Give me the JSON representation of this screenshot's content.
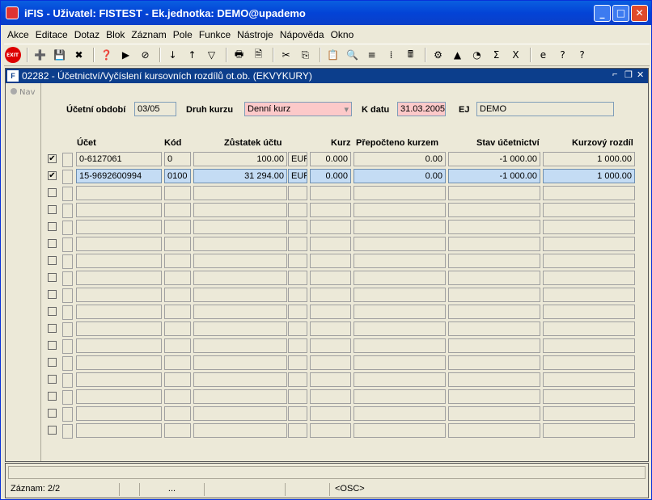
{
  "window": {
    "title": "iFIS - Uživatel: FISTEST - Ek.jednotka: DEMO@upademo",
    "minimize": "_",
    "maximize": "□",
    "close": "✕"
  },
  "menu": [
    "Akce",
    "Editace",
    "Dotaz",
    "Blok",
    "Záznam",
    "Pole",
    "Funkce",
    "Nástroje",
    "Nápověda",
    "Okno"
  ],
  "toolbar": {
    "exit_label": "EXIT",
    "icons": [
      "add-record-icon",
      "save-icon",
      "delete-icon",
      "query-icon",
      "execute-query-icon",
      "cancel-query-icon",
      "sort-asc-icon",
      "sort-desc-icon",
      "filter-icon",
      "print-icon",
      "print-preview-icon",
      "cut-icon",
      "copy-icon",
      "paste-icon",
      "search-icon",
      "list-icon",
      "tree-icon",
      "calculator-icon",
      "settings-icon",
      "chart-icon",
      "clock-icon",
      "sum-icon",
      "excel-icon",
      "browser-icon",
      "user-help-icon",
      "help-icon"
    ],
    "glyphs": [
      "➕",
      "💾",
      "✖",
      "❓",
      "▶",
      "⊘",
      "↓",
      "↑",
      "▽",
      "🖶",
      "🗎",
      "✂",
      "⎘",
      "📋",
      "🔍",
      "≡",
      "⁞",
      "🖩",
      "⚙",
      "▲",
      "◔",
      "Σ",
      "X",
      "e",
      "?",
      "?"
    ]
  },
  "form": {
    "title": "02282 - Účetnictví/Vyčíslení kursovních rozdílů ot.ob. (EKVYKURY)",
    "nav_label": "Nav",
    "labels": {
      "period": "Účetní období",
      "rate_type": "Druh kurzu",
      "date": "K datu",
      "ej": "EJ"
    },
    "values": {
      "period": "03/05",
      "rate_type": "Denní kurz",
      "date": "31.03.2005",
      "ej": "DEMO"
    }
  },
  "table": {
    "headers": [
      "Účet",
      "Kód",
      "Zůstatek účtu",
      "Kurz",
      "Přepočteno kurzem",
      "Stav účetnictví",
      "Kurzový rozdíl"
    ],
    "rows": [
      {
        "checked": true,
        "ucet": "0-6127061",
        "kod": "0",
        "zustatek": "100.00",
        "mena": "EUR",
        "kurz": "0.000",
        "prepocteno": "0.00",
        "stav": "-1 000.00",
        "rozdil": "1 000.00"
      },
      {
        "checked": true,
        "ucet": "15-9692600994",
        "kod": "0100",
        "zustatek": "31 294.00",
        "mena": "EUR",
        "kurz": "0.000",
        "prepocteno": "0.00",
        "stav": "-1 000.00",
        "rozdil": "1 000.00"
      }
    ]
  },
  "status": {
    "record": "Záznam: 2/2",
    "dots": "...",
    "osc": "<OSC>"
  }
}
